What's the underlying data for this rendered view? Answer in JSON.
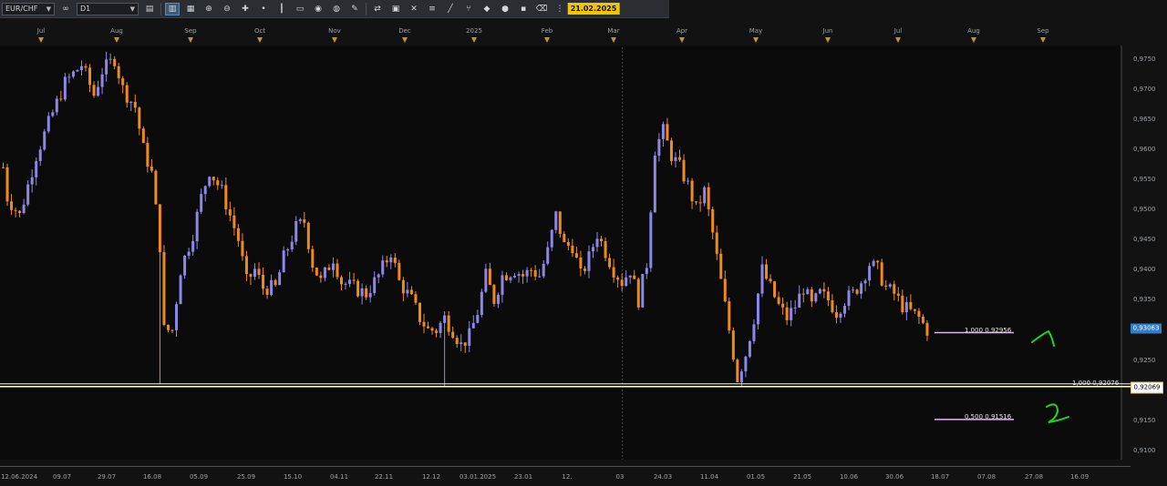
{
  "toolbar": {
    "symbol": "EUR/CHF",
    "timeframe": "D1"
  },
  "colors": {
    "background": "#0b0b0b",
    "bull": "#8d87e8",
    "bear": "#ef8a23",
    "level_line": "#ffffcc",
    "fib_line": "#e9b0ff",
    "annotation": "#1fd51f",
    "price_tag": "#2f7fd1"
  },
  "top_axis": {
    "labels": [
      "Jul",
      "Aug",
      "Sep",
      "Oct",
      "Nov",
      "Dec",
      "2025",
      "Feb",
      "Mar",
      "Apr",
      "May",
      "Jun",
      "Jul",
      "Aug",
      "Sep"
    ]
  },
  "bottom_axis": {
    "labels": [
      "12.06.2024",
      "09.07",
      "29.07",
      "16.08",
      "05.09",
      "25.09",
      "15.10",
      "04.11",
      "22.11",
      "12.12",
      "03.01.2025",
      "23.01",
      "12.",
      "03",
      "24.03",
      "11.04",
      "01.05",
      "21.05",
      "10.06",
      "30.06",
      "18.07",
      "07.08",
      "27.08",
      "16.09"
    ],
    "highlight": "21.02.2025"
  },
  "price_axis": {
    "labels": [
      "0,9750",
      "0,9700",
      "0,9650",
      "0,9600",
      "0,9550",
      "0,9500",
      "0,9450",
      "0,9400",
      "0,9350",
      "0,9300",
      "0,9250",
      "0,9200",
      "0,9150",
      "0,9100"
    ],
    "current_price": "0,93063",
    "level_price": "0,92069"
  },
  "levels": {
    "upper": "1,000 0,92956",
    "main": "1,000 0,92076",
    "lower": "0,500 0,91516"
  },
  "annotations": {
    "one": "1",
    "two": "2"
  },
  "chart_data": {
    "type": "candlestick",
    "symbol": "EUR/CHF",
    "timeframe": "D1",
    "ylim": [
      0.9085,
      0.9775
    ],
    "y_ticks": [
      0.975,
      0.97,
      0.965,
      0.96,
      0.955,
      0.95,
      0.945,
      0.94,
      0.935,
      0.93,
      0.925,
      0.92,
      0.915,
      0.91
    ],
    "horizontal_levels": [
      {
        "label": "1,000 0,92956",
        "price": 0.92956,
        "from": "2025-07-18",
        "to": "2025-08-15"
      },
      {
        "label": "1,000 0,92076",
        "price": 0.92076,
        "extends": "full-width"
      },
      {
        "label": "0,500 0,91516",
        "price": 0.91516,
        "from": "2025-07-18",
        "to": "2025-08-15"
      }
    ],
    "vertical_marker": "2025-02-21",
    "current_price": 0.93063,
    "x_dates": [
      "2024-06-12",
      "2024-07-09",
      "2024-07-29",
      "2024-08-16",
      "2024-09-05",
      "2024-09-25",
      "2024-10-15",
      "2024-11-04",
      "2024-11-22",
      "2024-12-12",
      "2025-01-03",
      "2025-01-23",
      "2025-02-21",
      "2025-03-03",
      "2025-03-24",
      "2025-04-11",
      "2025-05-01",
      "2025-05-21",
      "2025-06-10",
      "2025-06-30",
      "2025-07-18",
      "2025-08-07",
      "2025-08-27",
      "2025-09-16"
    ],
    "close_path": [
      [
        0,
        0.957
      ],
      [
        1,
        0.952
      ],
      [
        4,
        0.949
      ],
      [
        8,
        0.959
      ],
      [
        12,
        0.966
      ],
      [
        15,
        0.971
      ],
      [
        19,
        0.974
      ],
      [
        22,
        0.969
      ],
      [
        24,
        0.973
      ],
      [
        27,
        0.975
      ],
      [
        29,
        0.97
      ],
      [
        32,
        0.967
      ],
      [
        34,
        0.96
      ],
      [
        36,
        0.956
      ],
      [
        38,
        0.944
      ],
      [
        39,
        0.93
      ],
      [
        41,
        0.93
      ],
      [
        43,
        0.94
      ],
      [
        46,
        0.946
      ],
      [
        48,
        0.952
      ],
      [
        50,
        0.9565
      ],
      [
        53,
        0.953
      ],
      [
        55,
        0.949
      ],
      [
        57,
        0.945
      ],
      [
        59,
        0.938
      ],
      [
        61,
        0.94
      ],
      [
        63,
        0.937
      ],
      [
        66,
        0.937
      ],
      [
        68,
        0.942
      ],
      [
        71,
        0.947
      ],
      [
        73,
        0.948
      ],
      [
        75,
        0.941
      ],
      [
        77,
        0.938
      ],
      [
        80,
        0.942
      ],
      [
        82,
        0.938
      ],
      [
        85,
        0.937
      ],
      [
        88,
        0.936
      ],
      [
        91,
        0.939
      ],
      [
        94,
        0.943
      ],
      [
        96,
        0.938
      ],
      [
        99,
        0.935
      ],
      [
        101,
        0.932
      ],
      [
        103,
        0.93
      ],
      [
        105,
        0.93
      ],
      [
        107,
        0.932
      ],
      [
        109,
        0.93
      ],
      [
        111,
        0.9275
      ],
      [
        113,
        0.929
      ],
      [
        115,
        0.933
      ],
      [
        117,
        0.939
      ],
      [
        119,
        0.935
      ],
      [
        121,
        0.939
      ],
      [
        124,
        0.94
      ],
      [
        126,
        0.939
      ],
      [
        128,
        0.94
      ],
      [
        130,
        0.939
      ],
      [
        132,
        0.943
      ],
      [
        134,
        0.949
      ],
      [
        136,
        0.944
      ],
      [
        138,
        0.944
      ],
      [
        140,
        0.939
      ],
      [
        142,
        0.942
      ],
      [
        144,
        0.946
      ],
      [
        146,
        0.943
      ],
      [
        148,
        0.94
      ],
      [
        150,
        0.938
      ],
      [
        152,
        0.94
      ],
      [
        154,
        0.935
      ],
      [
        156,
        0.941
      ],
      [
        158,
        0.96
      ],
      [
        160,
        0.963
      ],
      [
        162,
        0.959
      ],
      [
        164,
        0.957
      ],
      [
        166,
        0.954
      ],
      [
        168,
        0.95
      ],
      [
        170,
        0.953
      ],
      [
        172,
        0.946
      ],
      [
        174,
        0.938
      ],
      [
        176,
        0.93
      ],
      [
        178,
        0.922
      ],
      [
        180,
        0.926
      ],
      [
        182,
        0.932
      ],
      [
        184,
        0.94
      ],
      [
        186,
        0.937
      ],
      [
        188,
        0.934
      ],
      [
        190,
        0.932
      ],
      [
        192,
        0.934
      ],
      [
        194,
        0.937
      ],
      [
        196,
        0.934
      ],
      [
        198,
        0.936
      ],
      [
        200,
        0.935
      ],
      [
        202,
        0.933
      ],
      [
        204,
        0.935
      ],
      [
        206,
        0.936
      ],
      [
        208,
        0.938
      ],
      [
        210,
        0.941
      ],
      [
        212,
        0.94
      ],
      [
        214,
        0.937
      ],
      [
        216,
        0.936
      ],
      [
        218,
        0.934
      ],
      [
        220,
        0.933
      ],
      [
        222,
        0.932
      ],
      [
        224,
        0.93
      ]
    ],
    "candle_count": 225
  }
}
